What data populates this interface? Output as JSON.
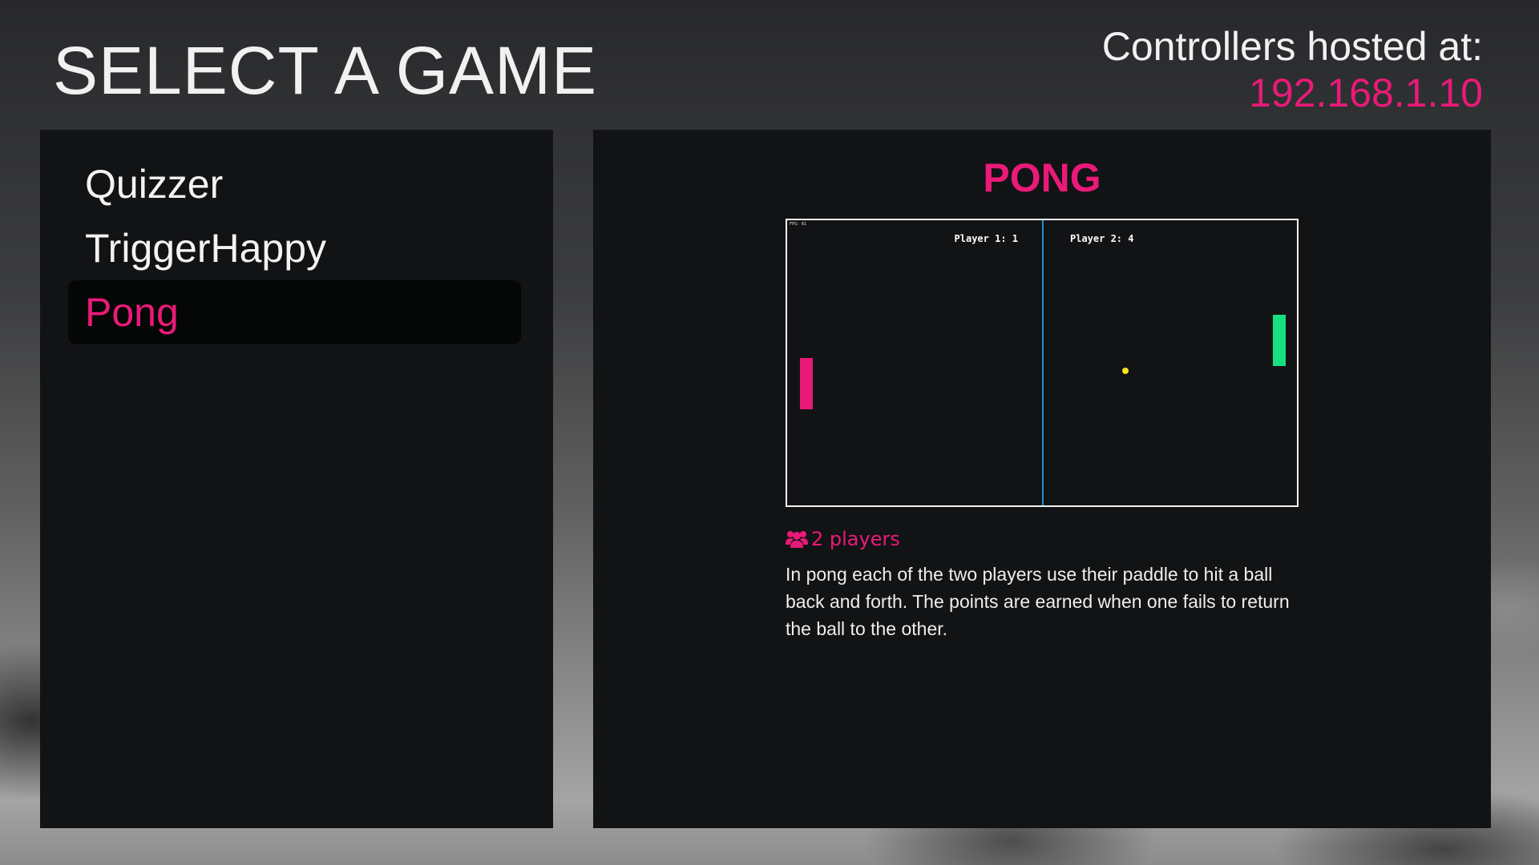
{
  "header": {
    "title": "SELECT A GAME",
    "host_label": "Controllers hosted at:",
    "host_address": "192.168.1.10"
  },
  "games": [
    {
      "label": "Quizzer",
      "selected": false
    },
    {
      "label": "TriggerHappy",
      "selected": false
    },
    {
      "label": "Pong",
      "selected": true
    }
  ],
  "details": {
    "title": "PONG",
    "preview": {
      "fps": "FPS: 61",
      "player1_score": "Player 1: 1",
      "player2_score": "Player 2: 4"
    },
    "players": "2 players",
    "players_icon": "users-icon",
    "description": "In pong each of the two players use their paddle to hit a ball back and forth. The points are earned when one fails to return the ball to the other."
  },
  "colors": {
    "accent": "#ea1a78",
    "panel_bg": "#121315",
    "player1_paddle": "#ea1a78",
    "player2_paddle": "#16e07f",
    "ball": "#f5e51a",
    "center_line": "#1e8ec8"
  }
}
